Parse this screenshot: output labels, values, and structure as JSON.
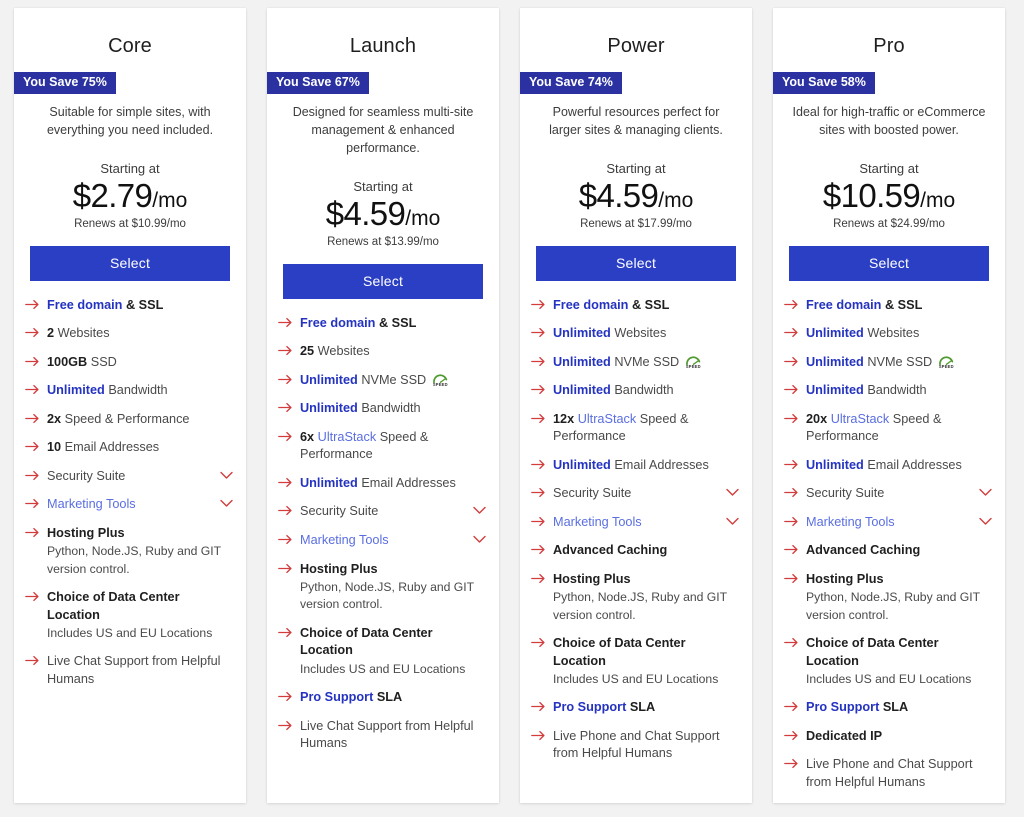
{
  "colors": {
    "badge_bg": "#2b31a0",
    "button_bg": "#2b3fc4",
    "arrow": "#d33c3c",
    "highlight_blue": "#2433c0",
    "highlight_light_blue": "#5a6ee0",
    "page_bg": "#f2f2f2",
    "card_bg": "#ffffff",
    "speed_green": "#4f9a2f"
  },
  "labels": {
    "starting_at": "Starting at",
    "select": "Select",
    "arrow_icon": "arrow-right-icon",
    "chevron_icon": "chevron-down-icon",
    "speed_icon": "speed-badge-icon",
    "speed_icon_text": "SPEED"
  },
  "plans": [
    {
      "name": "Core",
      "save_badge": "You Save 75%",
      "description": "Suitable for simple sites, with everything you need included.",
      "starting_at": "Starting at",
      "price": "$2.79",
      "period": "/mo",
      "renews": "Renews at $10.99/mo",
      "select_label": "Select",
      "features": [
        {
          "parts": [
            {
              "t": "Free domain",
              "s": "hl-blue"
            },
            {
              "t": " & SSL",
              "s": "hl-dark"
            }
          ]
        },
        {
          "parts": [
            {
              "t": "2",
              "s": "hl-dark"
            },
            {
              "t": " Websites",
              "s": "plain"
            }
          ]
        },
        {
          "parts": [
            {
              "t": "100GB",
              "s": "hl-dark"
            },
            {
              "t": " SSD",
              "s": "plain"
            }
          ]
        },
        {
          "parts": [
            {
              "t": "Unlimited",
              "s": "hl-blue"
            },
            {
              "t": " Bandwidth",
              "s": "plain"
            }
          ]
        },
        {
          "parts": [
            {
              "t": "2x",
              "s": "hl-dark"
            },
            {
              "t": " Speed & Performance",
              "s": "plain"
            }
          ]
        },
        {
          "parts": [
            {
              "t": "10",
              "s": "hl-dark"
            },
            {
              "t": " Email Addresses",
              "s": "plain"
            }
          ]
        },
        {
          "parts": [
            {
              "t": "Security Suite",
              "s": "plain"
            }
          ],
          "chevron": true
        },
        {
          "parts": [
            {
              "t": "Marketing Tools",
              "s": "hl-light"
            }
          ],
          "chevron": true
        },
        {
          "parts": [
            {
              "t": "Hosting Plus",
              "s": "hl-dark"
            }
          ],
          "sub": "Python,  Node.JS,  Ruby and GIT version control."
        },
        {
          "parts": [
            {
              "t": "Choice of Data Center Location",
              "s": "hl-dark"
            }
          ],
          "sub": "Includes US and EU Locations"
        },
        {
          "parts": [
            {
              "t": "Live Chat Support from Helpful Humans",
              "s": "plain"
            }
          ]
        }
      ]
    },
    {
      "name": "Launch",
      "save_badge": "You Save 67%",
      "description": "Designed for seamless multi-site management & enhanced performance.",
      "starting_at": "Starting at",
      "price": "$4.59",
      "period": "/mo",
      "renews": "Renews at $13.99/mo",
      "select_label": "Select",
      "features": [
        {
          "parts": [
            {
              "t": "Free domain",
              "s": "hl-blue"
            },
            {
              "t": " & SSL",
              "s": "hl-dark"
            }
          ]
        },
        {
          "parts": [
            {
              "t": "25",
              "s": "hl-dark"
            },
            {
              "t": " Websites",
              "s": "plain"
            }
          ]
        },
        {
          "parts": [
            {
              "t": "Unlimited",
              "s": "hl-blue"
            },
            {
              "t": " NVMe SSD",
              "s": "plain"
            }
          ],
          "speed": true
        },
        {
          "parts": [
            {
              "t": "Unlimited",
              "s": "hl-blue"
            },
            {
              "t": " Bandwidth",
              "s": "plain"
            }
          ]
        },
        {
          "parts": [
            {
              "t": "6x",
              "s": "hl-dark"
            },
            {
              "t": " ",
              "s": "plain"
            },
            {
              "t": "UltraStack",
              "s": "hl-light"
            },
            {
              "t": " Speed & Performance",
              "s": "plain"
            }
          ]
        },
        {
          "parts": [
            {
              "t": "Unlimited",
              "s": "hl-blue"
            },
            {
              "t": " Email Addresses",
              "s": "plain"
            }
          ]
        },
        {
          "parts": [
            {
              "t": "Security Suite",
              "s": "plain"
            }
          ],
          "chevron": true
        },
        {
          "parts": [
            {
              "t": "Marketing Tools",
              "s": "hl-light"
            }
          ],
          "chevron": true
        },
        {
          "parts": [
            {
              "t": "Hosting Plus",
              "s": "hl-dark"
            }
          ],
          "sub": "Python,  Node.JS,  Ruby and GIT version control."
        },
        {
          "parts": [
            {
              "t": "Choice of Data Center Location",
              "s": "hl-dark"
            }
          ],
          "sub": "Includes US and EU Locations"
        },
        {
          "parts": [
            {
              "t": "Pro Support",
              "s": "hl-blue"
            },
            {
              "t": " SLA",
              "s": "hl-dark"
            }
          ]
        },
        {
          "parts": [
            {
              "t": "Live Chat Support from Helpful Humans",
              "s": "plain"
            }
          ]
        }
      ]
    },
    {
      "name": "Power",
      "save_badge": "You Save 74%",
      "description": "Powerful resources perfect for larger sites & managing clients.",
      "starting_at": "Starting at",
      "price": "$4.59",
      "period": "/mo",
      "renews": "Renews at $17.99/mo",
      "select_label": "Select",
      "features": [
        {
          "parts": [
            {
              "t": "Free domain",
              "s": "hl-blue"
            },
            {
              "t": " & SSL",
              "s": "hl-dark"
            }
          ]
        },
        {
          "parts": [
            {
              "t": "Unlimited",
              "s": "hl-blue"
            },
            {
              "t": " Websites",
              "s": "plain"
            }
          ]
        },
        {
          "parts": [
            {
              "t": "Unlimited",
              "s": "hl-blue"
            },
            {
              "t": " NVMe SSD",
              "s": "plain"
            }
          ],
          "speed": true
        },
        {
          "parts": [
            {
              "t": "Unlimited",
              "s": "hl-blue"
            },
            {
              "t": " Bandwidth",
              "s": "plain"
            }
          ]
        },
        {
          "parts": [
            {
              "t": "12x",
              "s": "hl-dark"
            },
            {
              "t": " ",
              "s": "plain"
            },
            {
              "t": "UltraStack",
              "s": "hl-light"
            },
            {
              "t": " Speed & Performance",
              "s": "plain"
            }
          ]
        },
        {
          "parts": [
            {
              "t": "Unlimited",
              "s": "hl-blue"
            },
            {
              "t": " Email Addresses",
              "s": "plain"
            }
          ]
        },
        {
          "parts": [
            {
              "t": "Security Suite",
              "s": "plain"
            }
          ],
          "chevron": true
        },
        {
          "parts": [
            {
              "t": "Marketing Tools",
              "s": "hl-light"
            }
          ],
          "chevron": true
        },
        {
          "parts": [
            {
              "t": "Advanced Caching",
              "s": "hl-dark"
            }
          ]
        },
        {
          "parts": [
            {
              "t": "Hosting Plus",
              "s": "hl-dark"
            }
          ],
          "sub": "Python,  Node.JS,  Ruby and GIT version control."
        },
        {
          "parts": [
            {
              "t": "Choice of Data Center Location",
              "s": "hl-dark"
            }
          ],
          "sub": "Includes US and EU Locations"
        },
        {
          "parts": [
            {
              "t": "Pro Support",
              "s": "hl-blue"
            },
            {
              "t": " SLA",
              "s": "hl-dark"
            }
          ]
        },
        {
          "parts": [
            {
              "t": "Live Phone and Chat Support from Helpful Humans",
              "s": "plain"
            }
          ]
        }
      ]
    },
    {
      "name": "Pro",
      "save_badge": "You Save 58%",
      "description": "Ideal for high-traffic or eCommerce sites with boosted power.",
      "starting_at": "Starting at",
      "price": "$10.59",
      "period": "/mo",
      "renews": "Renews at $24.99/mo",
      "select_label": "Select",
      "features": [
        {
          "parts": [
            {
              "t": "Free domain",
              "s": "hl-blue"
            },
            {
              "t": " & SSL",
              "s": "hl-dark"
            }
          ]
        },
        {
          "parts": [
            {
              "t": "Unlimited",
              "s": "hl-blue"
            },
            {
              "t": " Websites",
              "s": "plain"
            }
          ]
        },
        {
          "parts": [
            {
              "t": "Unlimited",
              "s": "hl-blue"
            },
            {
              "t": " NVMe SSD",
              "s": "plain"
            }
          ],
          "speed": true
        },
        {
          "parts": [
            {
              "t": "Unlimited",
              "s": "hl-blue"
            },
            {
              "t": " Bandwidth",
              "s": "plain"
            }
          ]
        },
        {
          "parts": [
            {
              "t": "20x",
              "s": "hl-dark"
            },
            {
              "t": " ",
              "s": "plain"
            },
            {
              "t": "UltraStack",
              "s": "hl-light"
            },
            {
              "t": " Speed & Performance",
              "s": "plain"
            }
          ]
        },
        {
          "parts": [
            {
              "t": "Unlimited",
              "s": "hl-blue"
            },
            {
              "t": " Email Addresses",
              "s": "plain"
            }
          ]
        },
        {
          "parts": [
            {
              "t": "Security Suite",
              "s": "plain"
            }
          ],
          "chevron": true
        },
        {
          "parts": [
            {
              "t": "Marketing Tools",
              "s": "hl-light"
            }
          ],
          "chevron": true
        },
        {
          "parts": [
            {
              "t": "Advanced Caching",
              "s": "hl-dark"
            }
          ]
        },
        {
          "parts": [
            {
              "t": "Hosting Plus",
              "s": "hl-dark"
            }
          ],
          "sub": "Python,  Node.JS,  Ruby and GIT version control."
        },
        {
          "parts": [
            {
              "t": "Choice of Data Center Location",
              "s": "hl-dark"
            }
          ],
          "sub": "Includes US and EU Locations"
        },
        {
          "parts": [
            {
              "t": "Pro Support",
              "s": "hl-blue"
            },
            {
              "t": " SLA",
              "s": "hl-dark"
            }
          ]
        },
        {
          "parts": [
            {
              "t": "Dedicated IP",
              "s": "hl-dark"
            }
          ]
        },
        {
          "parts": [
            {
              "t": "Live Phone and Chat Support from Helpful Humans",
              "s": "plain"
            }
          ]
        }
      ]
    }
  ]
}
